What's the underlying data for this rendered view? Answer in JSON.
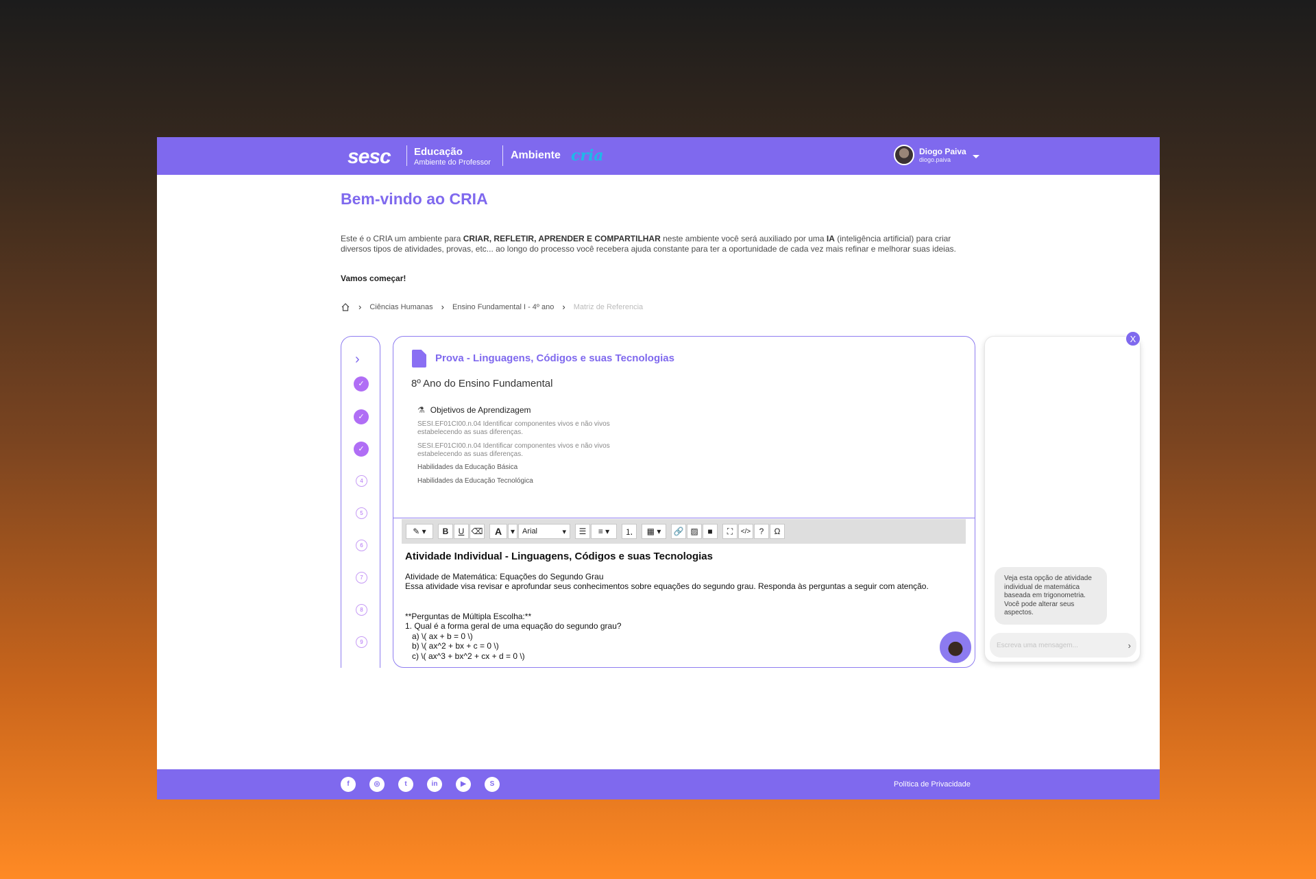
{
  "header": {
    "logo": "sesc",
    "edu_title": "Educação",
    "edu_subtitle": "Ambiente do Professor",
    "ambiente": "Ambiente",
    "cria_logo": "cria",
    "user_name": "Diogo Paiva",
    "user_login": "diogo.paiva"
  },
  "page": {
    "title": "Bem-vindo ao CRIA",
    "intro_1": "Este é o CRIA um ambiente para ",
    "intro_bold_1": "CRIAR,  REFLETIR, APRENDER E COMPARTILHAR",
    "intro_2": " neste ambiente você será auxiliado por uma ",
    "intro_bold_2": "IA",
    "intro_3": " (inteligência artificial) para criar diversos tipos de atividades, provas, etc... ao longo do processo você recebera ajuda constante para ter a oportunidade de cada vez mais refinar e melhorar suas ideias.",
    "start": "Vamos começar!"
  },
  "breadcrumb": {
    "items": [
      "Ciências Humanas",
      "Ensino Fundamental I - 4º ano",
      "Matriz de Referencia"
    ]
  },
  "steps": {
    "done": [
      "✓",
      "✓",
      "✓"
    ],
    "todo": [
      "4",
      "5",
      "6",
      "7",
      "8",
      "9"
    ]
  },
  "card": {
    "title": "Prova - Linguagens, Códigos e suas Tecnologias",
    "grade": "8º Ano do Ensino Fundamental",
    "objectives_label": "Objetivos de Aprendizagem",
    "codes": [
      "SESI.EF01CI00.n.04 Identificar componentes vivos e não vivos estabelecendo as suas diferenças.",
      "SESI.EF01CI00.n.04 Identificar componentes vivos e não vivos estabelecendo as suas diferenças."
    ],
    "hab_basic": "Habilidades da Educação Básica",
    "hab_tech": "Habilidades da Educação Tecnológica"
  },
  "toolbar": {
    "bold": "B",
    "underline": "U",
    "font_color": "A",
    "font": "Arial",
    "help": "?",
    "omega": "Ω"
  },
  "editor": {
    "heading": "Atividade Individual - Linguagens, Códigos e suas Tecnologias",
    "lines": [
      "Atividade de Matemática: Equações do Segundo Grau",
      "Essa atividade visa revisar e aprofundar seus conhecimentos sobre equações do segundo grau. Responda às perguntas a seguir com atenção.",
      "",
      "**Perguntas de Múltipla Escolha:**",
      "1. Qual é a forma geral de uma equação do segundo grau?",
      "   a) \\( ax + b = 0 \\)",
      "   b) \\( ax^2 + bx + c = 0 \\)",
      "   c) \\( ax^3 + bx^2 + cx + d = 0 \\)"
    ]
  },
  "chat": {
    "close": "X",
    "message": "Veja esta opção de atividade individual de matemática baseada em trigonometria. Você pode alterar seus aspectos.",
    "placeholder": "Escreva uma mensagem...",
    "send": "›"
  },
  "footer": {
    "social": [
      "f",
      "◎",
      "t",
      "in",
      "▶",
      "S"
    ],
    "privacy": "Política de Privacidade"
  },
  "colors": {
    "brand": "#7f69ee",
    "step_done": "#b06ef5",
    "cria_logo": "#1fb8e8"
  }
}
